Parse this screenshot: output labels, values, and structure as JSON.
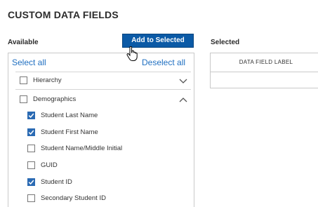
{
  "title": "CUSTOM DATA FIELDS",
  "available_label": "Available",
  "selected_label": "Selected",
  "add_button": "Add to Selected",
  "select_all": "Select all",
  "deselect_all": "Deselect all",
  "groups": [
    {
      "label": "Hierarchy",
      "checked": false,
      "expanded": false
    },
    {
      "label": "Demographics",
      "checked": false,
      "expanded": true
    }
  ],
  "fields": [
    {
      "label": "Student Last Name",
      "checked": true
    },
    {
      "label": "Student First Name",
      "checked": true
    },
    {
      "label": "Student Name/Middle Initial",
      "checked": false
    },
    {
      "label": "GUID",
      "checked": false
    },
    {
      "label": "Student ID",
      "checked": true
    },
    {
      "label": "Secondary Student ID",
      "checked": false
    }
  ],
  "selected_table": {
    "header": "DATA FIELD LABEL"
  },
  "colors": {
    "accent": "#0b5aa6",
    "link": "#1f6fc1",
    "check": "#2a6ab3"
  }
}
